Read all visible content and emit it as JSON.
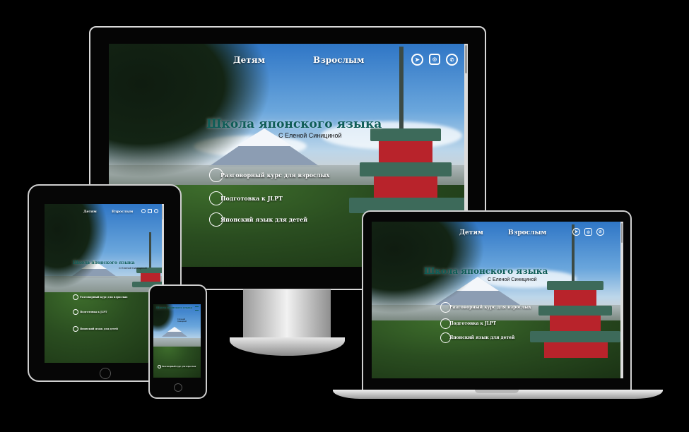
{
  "site": {
    "title": "Школа японского языка",
    "subtitle": "С Еленой Синициной"
  },
  "nav": {
    "kids": "Детям",
    "adults": "Взрослым"
  },
  "social_icons": [
    "telegram-icon",
    "instagram-icon",
    "whatsapp-icon"
  ],
  "courses": [
    "Разговорный курс для взрослых",
    "Подготовка к JLPT",
    "Японский язык для детей"
  ],
  "colors": {
    "background": "#000000",
    "title": "#0f5d57",
    "pagoda": "#b8232b"
  }
}
